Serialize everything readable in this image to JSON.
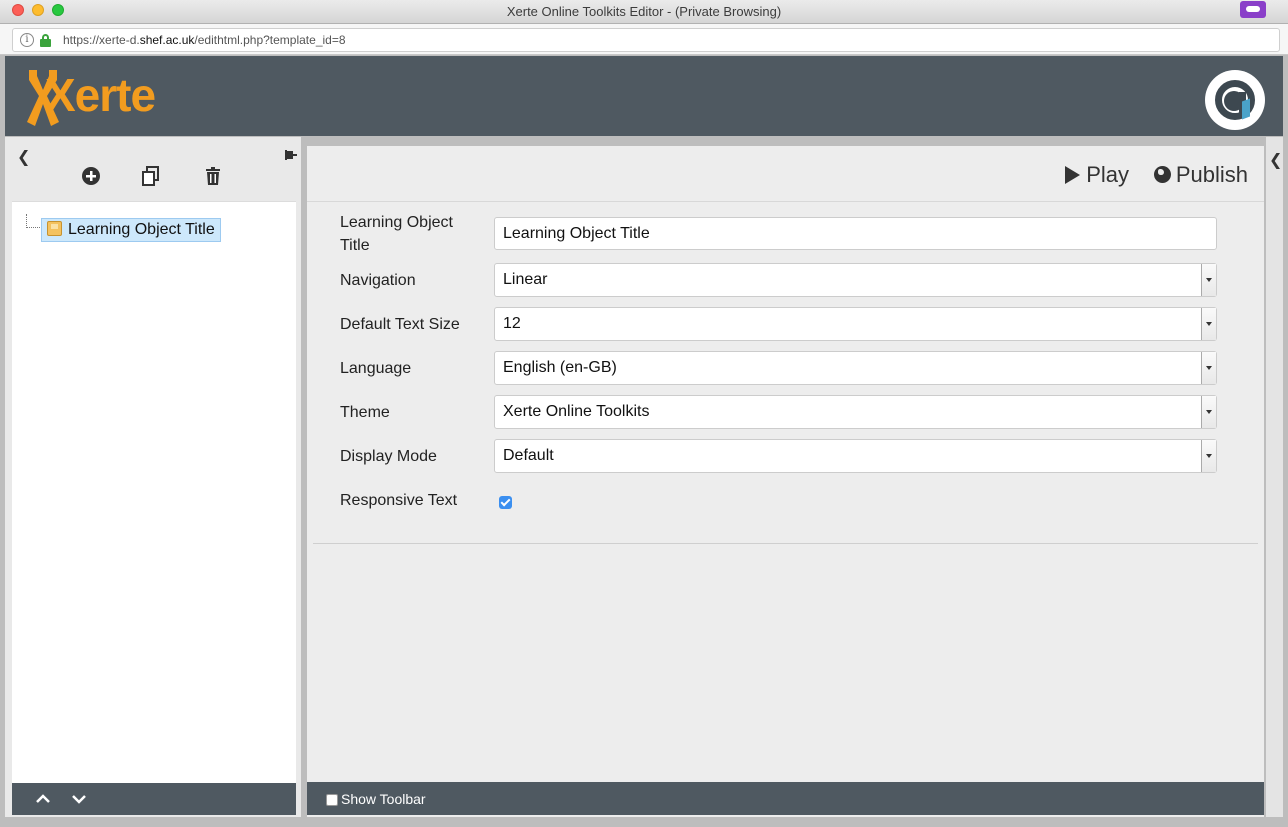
{
  "window": {
    "title": "Xerte Online Toolkits Editor - (Private Browsing)",
    "url_prefix": "https://xerte-d.",
    "url_host": "shef.ac.uk",
    "url_path": "/edithtml.php?template_id=8"
  },
  "header": {
    "logo_text": "Xerte"
  },
  "tree": {
    "toolbar": [
      "add-icon",
      "duplicate-icon",
      "delete-icon"
    ],
    "root_node": "Learning Object Title"
  },
  "actions": {
    "play": "Play",
    "publish": "Publish"
  },
  "properties": {
    "title_label": "Learning Object Title",
    "title_value": "Learning Object Title",
    "navigation_label": "Navigation",
    "navigation_value": "Linear",
    "text_size_label": "Default Text Size",
    "text_size_value": "12",
    "language_label": "Language",
    "language_value": "English (en-GB)",
    "theme_label": "Theme",
    "theme_value": "Xerte Online Toolkits",
    "display_mode_label": "Display Mode",
    "display_mode_value": "Default",
    "responsive_label": "Responsive Text",
    "responsive_checked": true
  },
  "footer": {
    "show_toolbar_label": "Show Toolbar",
    "show_toolbar_checked": false
  },
  "colors": {
    "header_bg": "#4f5961",
    "brand_orange": "#f29c1f",
    "selection": "#cde8fb"
  }
}
